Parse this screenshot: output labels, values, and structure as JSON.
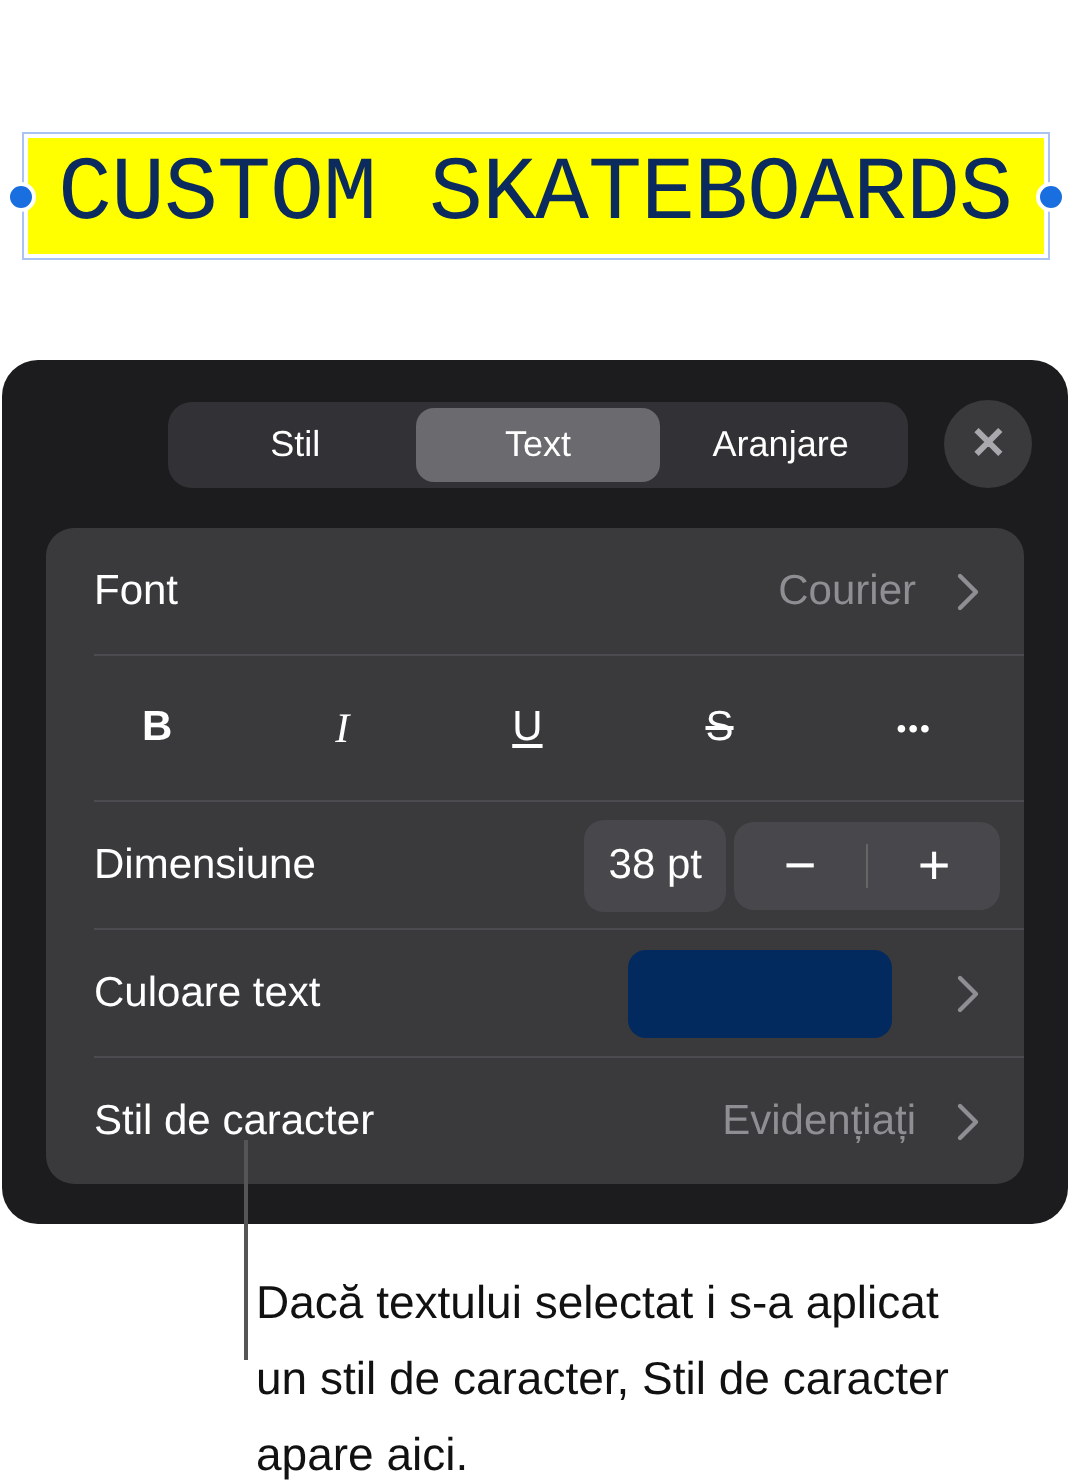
{
  "canvas": {
    "title": "CUSTOM SKATEBOARDS"
  },
  "tabs": [
    {
      "label": "Stil",
      "selected": false
    },
    {
      "label": "Text",
      "selected": true
    },
    {
      "label": "Aranjare",
      "selected": false
    }
  ],
  "close_button": {
    "label": "✕"
  },
  "font_row": {
    "label": "Font",
    "value": "Courier"
  },
  "format_buttons": [
    {
      "kind": "bold",
      "label": "B"
    },
    {
      "kind": "italic",
      "label": "I"
    },
    {
      "kind": "underline",
      "label": "U"
    },
    {
      "kind": "strike",
      "label": "S"
    },
    {
      "kind": "more",
      "label": "•••"
    }
  ],
  "size_row": {
    "label": "Dimensiune",
    "value": "38 pt",
    "decrease": "−",
    "increase": "+"
  },
  "color_row": {
    "label": "Culoare text",
    "color": "#022a5e"
  },
  "char_style_row": {
    "label": "Stil de caracter",
    "value": "Evidențiați"
  },
  "callout": {
    "text": "Dacă textului selectat i s-a aplicat un stil de caracter, Stil de caracter apare aici."
  }
}
